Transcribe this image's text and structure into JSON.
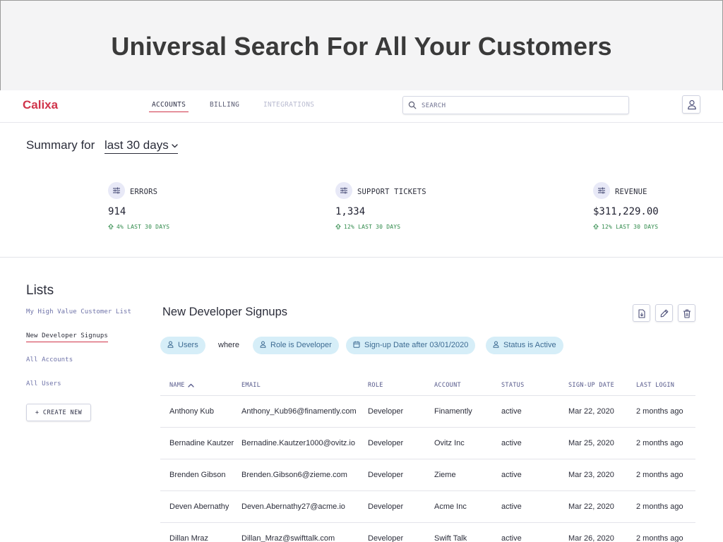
{
  "banner": {
    "title": "Universal Search For All Your Customers"
  },
  "app": {
    "logo": "Calixa",
    "nav": [
      {
        "label": "ACCOUNTS",
        "state": "active"
      },
      {
        "label": "BILLING",
        "state": "normal"
      },
      {
        "label": "INTEGRATIONS",
        "state": "disabled"
      }
    ],
    "search": {
      "placeholder": "SEARCH",
      "value": ""
    },
    "user_icon": "user-icon"
  },
  "summary": {
    "prefix": "Summary for",
    "range": "last 30 days",
    "metrics": [
      {
        "label": "ERRORS",
        "value": "914",
        "trend": "4% LAST 30 DAYS",
        "icon": "sliders-icon"
      },
      {
        "label": "SUPPORT TICKETS",
        "value": "1,334",
        "trend": "12% LAST 30 DAYS",
        "icon": "sliders-icon"
      },
      {
        "label": "REVENUE",
        "value": "$311,229.00",
        "trend": "12% LAST 30 DAYS",
        "icon": "sliders-icon"
      }
    ]
  },
  "lists": {
    "title": "Lists",
    "items": [
      {
        "label": "My High Value Customer List",
        "active": false
      },
      {
        "label": "New Developer Signups",
        "active": true
      },
      {
        "label": "All Accounts",
        "active": false
      },
      {
        "label": "All Users",
        "active": false
      }
    ],
    "create_label": "+ CREATE NEW"
  },
  "current_list": {
    "title": "New Developer Signups",
    "filters": {
      "subject": "Users",
      "connector": "where",
      "conditions": [
        "Role is Developer",
        "Sign-up Date after 03/01/2020",
        "Status is Active"
      ]
    },
    "columns": [
      "NAME",
      "EMAIL",
      "ROLE",
      "ACCOUNT",
      "STATUS",
      "SIGN-UP DATE",
      "LAST LOGIN"
    ],
    "sorted_column": "NAME",
    "rows": [
      [
        "Anthony Kub",
        "Anthony_Kub96@finamently.com",
        "Developer",
        "Finamently",
        "active",
        "Mar 22, 2020",
        "2 months ago"
      ],
      [
        "Bernadine Kautzer",
        "Bernadine.Kautzer1000@ovitz.io",
        "Developer",
        "Ovitz Inc",
        "active",
        "Mar 25, 2020",
        "2 months ago"
      ],
      [
        "Brenden Gibson",
        "Brenden.Gibson6@zieme.com",
        "Developer",
        "Zieme",
        "active",
        "Mar 23, 2020",
        "2 months ago"
      ],
      [
        "Deven Abernathy",
        "Deven.Abernathy27@acme.io",
        "Developer",
        "Acme Inc",
        "active",
        "Mar 22, 2020",
        "2 months ago"
      ],
      [
        "Dillan Mraz",
        "Dillan_Mraz@swifttalk.com",
        "Developer",
        "Swift Talk",
        "active",
        "Mar 26, 2020",
        "2 months ago"
      ]
    ]
  },
  "colors": {
    "accent": "#d0344a",
    "chip_bg": "#d6eef8",
    "chip_text": "#3d6b92",
    "trend_up": "#2f8a4a"
  }
}
